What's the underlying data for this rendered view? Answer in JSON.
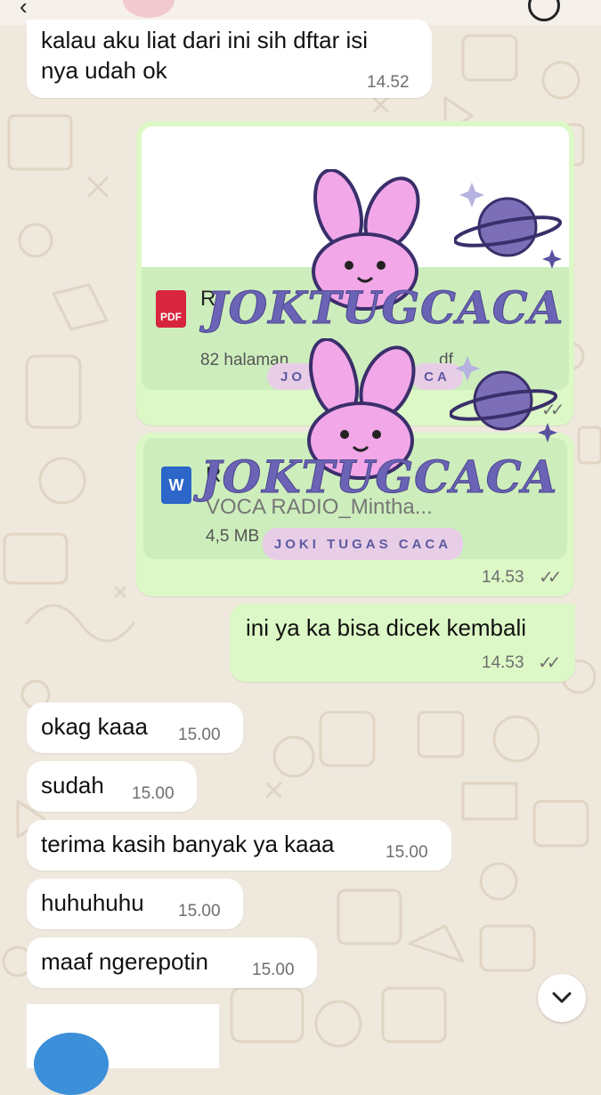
{
  "messages": [
    {
      "text_line1": "kalau aku liat dari ini sih dftar isi",
      "text_line2": "nya udah ok",
      "time": "14.52"
    },
    {
      "text": "ini ya ka bisa dicek kembali",
      "time": "14.53"
    },
    {
      "text": "okag kaaa",
      "time": "15.00"
    },
    {
      "text": "sudah",
      "time": "15.00"
    },
    {
      "text": "terima kasih banyak ya kaaa",
      "time": "15.00"
    },
    {
      "text": "huhuhuhu",
      "time": "15.00"
    },
    {
      "text": "maaf ngerepotin",
      "time": "15.00"
    }
  ],
  "files": [
    {
      "icon_label": "PDF",
      "name": "R",
      "meta": "82 halaman",
      "meta_ext": "df",
      "time": ""
    },
    {
      "icon_label": "W",
      "name": "R",
      "name_line2": "VOCA RADIO_Mintha...",
      "meta": "4,5 MB",
      "time": "14.53"
    }
  ],
  "watermark": {
    "text": "JOKTUGCACA",
    "label": "JOKI TUGAS CACA",
    "label_short_left": "JO",
    "label_short_right": "CA"
  },
  "icons": {
    "pdf": "pdf-file-icon",
    "word": "word-file-icon",
    "ticks": "double-check-icon",
    "scroll": "chevron-down-icon",
    "back": "back-arrow-icon"
  },
  "colors": {
    "chat_bg": "#efe8dd",
    "incoming": "#ffffff",
    "outgoing": "#dcf8c6",
    "watermark": "#6b63b5",
    "bunny": "#f1a7e8"
  }
}
